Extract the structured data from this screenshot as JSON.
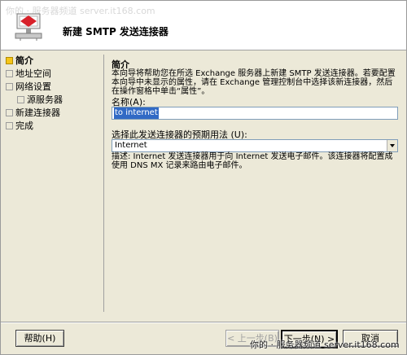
{
  "watermark": "你的 · 服务器频道  server.it168.com",
  "header": {
    "title": "新建 SMTP 发送连接器"
  },
  "sidebar": {
    "items": [
      {
        "label": "简介"
      },
      {
        "label": "地址空间"
      },
      {
        "label": "网络设置"
      },
      {
        "label": "源服务器"
      },
      {
        "label": "新建连接器"
      },
      {
        "label": "完成"
      }
    ]
  },
  "main": {
    "section_title": "简介",
    "intro": "本向导将帮助您在所选 Exchange 服务器上新建 SMTP 发送连接器。若要配置本向导中未显示的属性，请在 Exchange 管理控制台中选择该新连接器，然后在操作窗格中单击“属性”。",
    "name_label": "名称(A):",
    "name_value": "to internet",
    "purpose_label": "选择此发送连接器的预期用法 (U):",
    "purpose_value": "Internet",
    "description": "描述: Internet 发送连接器用于向 Internet 发送电子邮件。该连接器将配置成使用 DNS MX 记录来路由电子邮件。"
  },
  "buttons": {
    "help": "帮助(H)",
    "back": "< 上一步(B)",
    "next": "下一步(N) >",
    "cancel": "取消"
  },
  "footer_watermark": "你的 · 服务器频道  server.it168.com"
}
